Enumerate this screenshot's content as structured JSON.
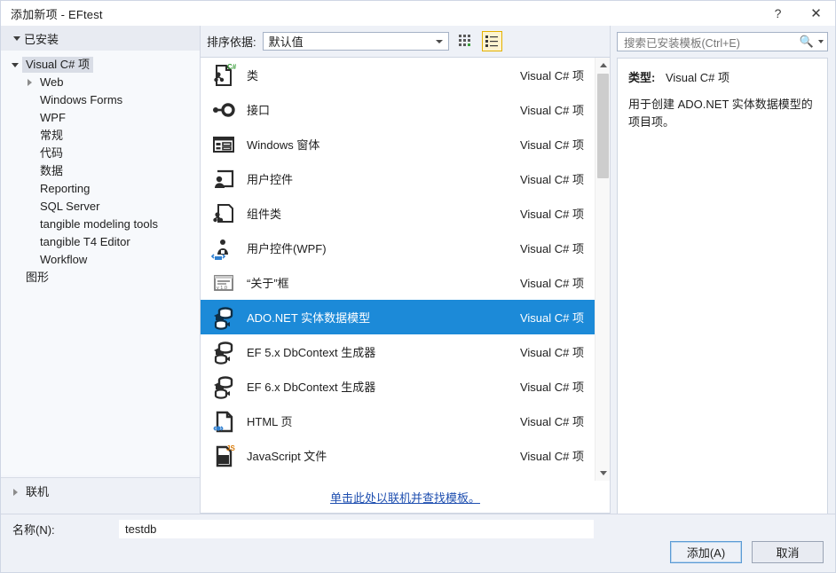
{
  "window": {
    "title": "添加新项 - EFtest",
    "help_label": "?",
    "close_label": "✕"
  },
  "sidebar": {
    "header": "已安装",
    "root": "Visual C# 项",
    "items": [
      {
        "label": "Web",
        "level": 2,
        "expandable": true
      },
      {
        "label": "Windows Forms",
        "level": 2,
        "expandable": false
      },
      {
        "label": "WPF",
        "level": 2,
        "expandable": false
      },
      {
        "label": "常规",
        "level": 2,
        "expandable": false
      },
      {
        "label": "代码",
        "level": 2,
        "expandable": false
      },
      {
        "label": "数据",
        "level": 2,
        "expandable": false
      },
      {
        "label": "Reporting",
        "level": 2,
        "expandable": false
      },
      {
        "label": "SQL Server",
        "level": 2,
        "expandable": false
      },
      {
        "label": "tangible modeling tools",
        "level": 2,
        "expandable": false
      },
      {
        "label": "tangible T4 Editor",
        "level": 2,
        "expandable": false
      },
      {
        "label": "Workflow",
        "level": 2,
        "expandable": false
      },
      {
        "label": "图形",
        "level": 1,
        "expandable": false
      }
    ],
    "online": "联机"
  },
  "toolbar": {
    "sort_label": "排序依据:",
    "sort_value": "默认值",
    "grid_view_tooltip": "中等图标",
    "list_view_tooltip": "列表视图"
  },
  "templates": {
    "kind_label": "Visual C# 项",
    "selected_index": 7,
    "items": [
      {
        "name": "类",
        "kind": "Visual C# 项",
        "icon": "class-icon"
      },
      {
        "name": "接口",
        "kind": "Visual C# 项",
        "icon": "interface-icon"
      },
      {
        "name": "Windows 窗体",
        "kind": "Visual C# 项",
        "icon": "windows-form-icon"
      },
      {
        "name": "用户控件",
        "kind": "Visual C# 项",
        "icon": "user-control-icon"
      },
      {
        "name": "组件类",
        "kind": "Visual C# 项",
        "icon": "component-class-icon"
      },
      {
        "name": "用户控件(WPF)",
        "kind": "Visual C# 项",
        "icon": "user-control-wpf-icon"
      },
      {
        "name": "“关于”框",
        "kind": "Visual C# 项",
        "icon": "about-box-icon"
      },
      {
        "name": "ADO.NET 实体数据模型",
        "kind": "Visual C# 项",
        "icon": "ado-net-entity-model-icon"
      },
      {
        "name": "EF 5.x DbContext 生成器",
        "kind": "Visual C# 项",
        "icon": "ef-dbcontext-icon"
      },
      {
        "name": "EF 6.x DbContext 生成器",
        "kind": "Visual C# 项",
        "icon": "ef-dbcontext-icon"
      },
      {
        "name": "HTML 页",
        "kind": "Visual C# 项",
        "icon": "html-page-icon"
      },
      {
        "name": "JavaScript 文件",
        "kind": "Visual C# 项",
        "icon": "javascript-file-icon"
      }
    ],
    "online_link": "单击此处以联机并查找模板。"
  },
  "search": {
    "placeholder": "搜索已安装模板(Ctrl+E)"
  },
  "details": {
    "type_label": "类型:",
    "type_value": "Visual C# 项",
    "description": "用于创建 ADO.NET 实体数据模型的项目项。"
  },
  "footer": {
    "name_label": "名称(N):",
    "name_value": "testdb",
    "add_label": "添加(A)",
    "cancel_label": "取消"
  },
  "colors": {
    "selection_blue": "#1c8ad8",
    "link_blue": "#1f4fb0",
    "panel_bg": "#eef1f7",
    "accent_gold": "#e3b100"
  }
}
